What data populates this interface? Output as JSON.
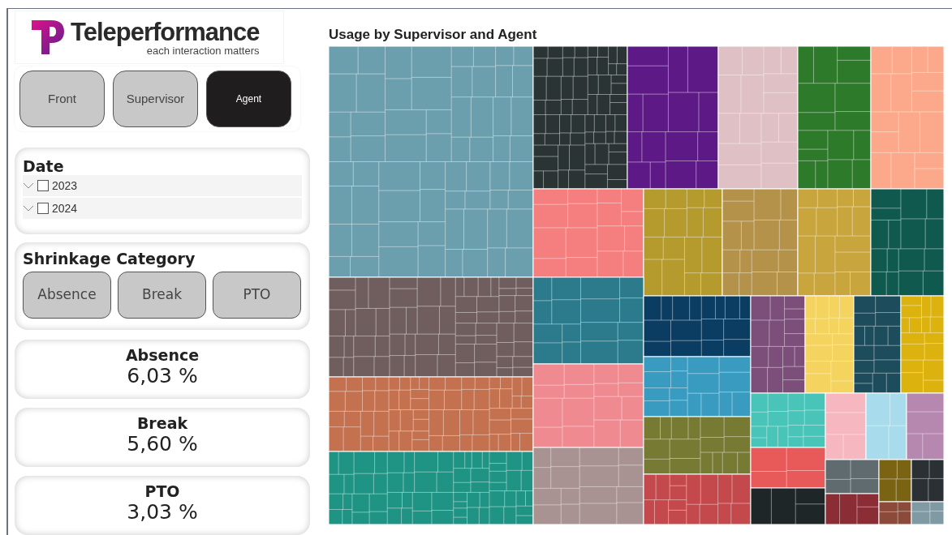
{
  "logo": {
    "name": "Teleperformance",
    "tagline": "each interaction matters"
  },
  "nav_buttons": [
    {
      "label": "Front",
      "selected": false
    },
    {
      "label": "Supervisor",
      "selected": false
    },
    {
      "label": "Agent",
      "selected": true
    }
  ],
  "date_filter": {
    "title": "Date",
    "items": [
      {
        "label": "2023",
        "checked": false
      },
      {
        "label": "2024",
        "checked": false
      }
    ]
  },
  "shrinkage_filter": {
    "title": "Shrinkage Category",
    "buttons": [
      {
        "label": "Absence",
        "selected": false
      },
      {
        "label": "Break",
        "selected": false
      },
      {
        "label": "PTO",
        "selected": false
      }
    ]
  },
  "kpis": [
    {
      "label": "Absence",
      "value": "6,03 %"
    },
    {
      "label": "Break",
      "value": "5,60 %"
    },
    {
      "label": "PTO",
      "value": "3,03 %"
    }
  ],
  "chart": {
    "title": "Usage by Supervisor and Agent"
  }
}
